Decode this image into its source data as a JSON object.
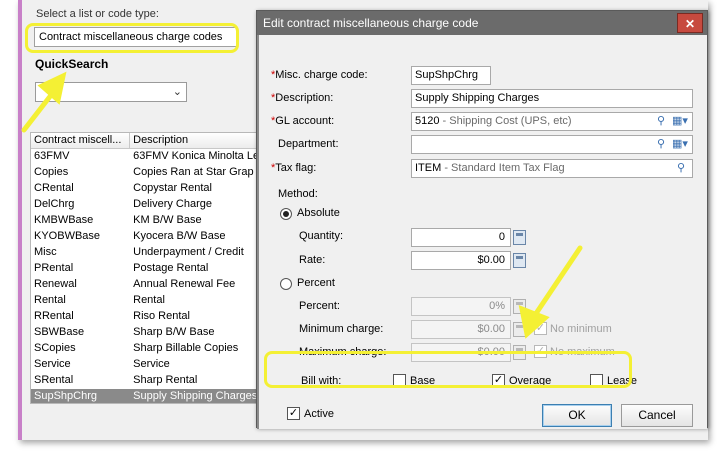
{
  "background_app": {
    "list_type_label": "Select a list or code type:",
    "list_type_value": "Contract miscellaneous charge codes",
    "quicksearch_title": "QuickSearch",
    "quicksearch_value": "",
    "table": {
      "columns": [
        "Contract miscell...",
        "Description"
      ],
      "rows": [
        {
          "code": "63FMV",
          "desc": "63FMV Konica Minolta Le"
        },
        {
          "code": "Copies",
          "desc": "Copies Ran at Star Grap"
        },
        {
          "code": "CRental",
          "desc": "Copystar Rental"
        },
        {
          "code": "DelChrg",
          "desc": "Delivery Charge"
        },
        {
          "code": "KMBWBase",
          "desc": "KM B/W Base"
        },
        {
          "code": "KYOBWBase",
          "desc": "Kyocera B/W Base"
        },
        {
          "code": "Misc",
          "desc": "Underpayment / Credit"
        },
        {
          "code": "PRental",
          "desc": "Postage Rental"
        },
        {
          "code": "Renewal",
          "desc": "Annual Renewal Fee"
        },
        {
          "code": "Rental",
          "desc": "Rental"
        },
        {
          "code": "RRental",
          "desc": "Riso Rental"
        },
        {
          "code": "SBWBase",
          "desc": "Sharp B/W Base"
        },
        {
          "code": "SCopies",
          "desc": "Sharp Billable Copies"
        },
        {
          "code": "Service",
          "desc": "Service"
        },
        {
          "code": "SRental",
          "desc": "Sharp Rental"
        },
        {
          "code": "SupShpChrg",
          "desc": "Supply Shipping Charges"
        }
      ],
      "selected_index": 15
    }
  },
  "dialog": {
    "title": "Edit contract miscellaneous charge code",
    "close_glyph": "✕",
    "fields": {
      "misc_code_label": "Misc. charge code:",
      "misc_code_value": "SupShpChrg",
      "description_label": "Description:",
      "description_value": "Supply Shipping Charges",
      "gl_label": "GL account:",
      "gl_value": "5120",
      "gl_hint": " - Shipping Cost (UPS, etc)",
      "department_label": "Department:",
      "department_value": "",
      "tax_label": "Tax flag:",
      "tax_value": "ITEM",
      "tax_hint": " - Standard Item Tax Flag",
      "required_marker": "*"
    },
    "method": {
      "label": "Method:",
      "absolute_label": "Absolute",
      "absolute_selected": true,
      "quantity_label": "Quantity:",
      "quantity_value": "0",
      "rate_label": "Rate:",
      "rate_value": "$0.00",
      "percent_label": "Percent",
      "percent_selected": false,
      "percent_field_label": "Percent:",
      "percent_value": "0%",
      "min_label": "Minimum charge:",
      "min_value": "$0.00",
      "no_min_label": "No minimum",
      "max_label": "Maximum charge:",
      "max_value": "$0.00",
      "no_max_label": "No maximum"
    },
    "bill_with": {
      "label": "Bill with:",
      "options": [
        {
          "label": "Base",
          "checked": false
        },
        {
          "label": "Overage",
          "checked": true
        },
        {
          "label": "Lease",
          "checked": false
        }
      ]
    },
    "active_label": "Active",
    "active_checked": true,
    "ok_label": "OK",
    "cancel_label": "Cancel",
    "icons": {
      "search": "search-icon",
      "lookup": "lookup-dropdown-icon",
      "calculator": "calculator-icon"
    }
  },
  "colors": {
    "highlight": "#f4f034",
    "titlebar": "#6b6b6b",
    "close": "#c74a3f",
    "selected_row": "#8a8a8a",
    "required": "#cc0000"
  }
}
